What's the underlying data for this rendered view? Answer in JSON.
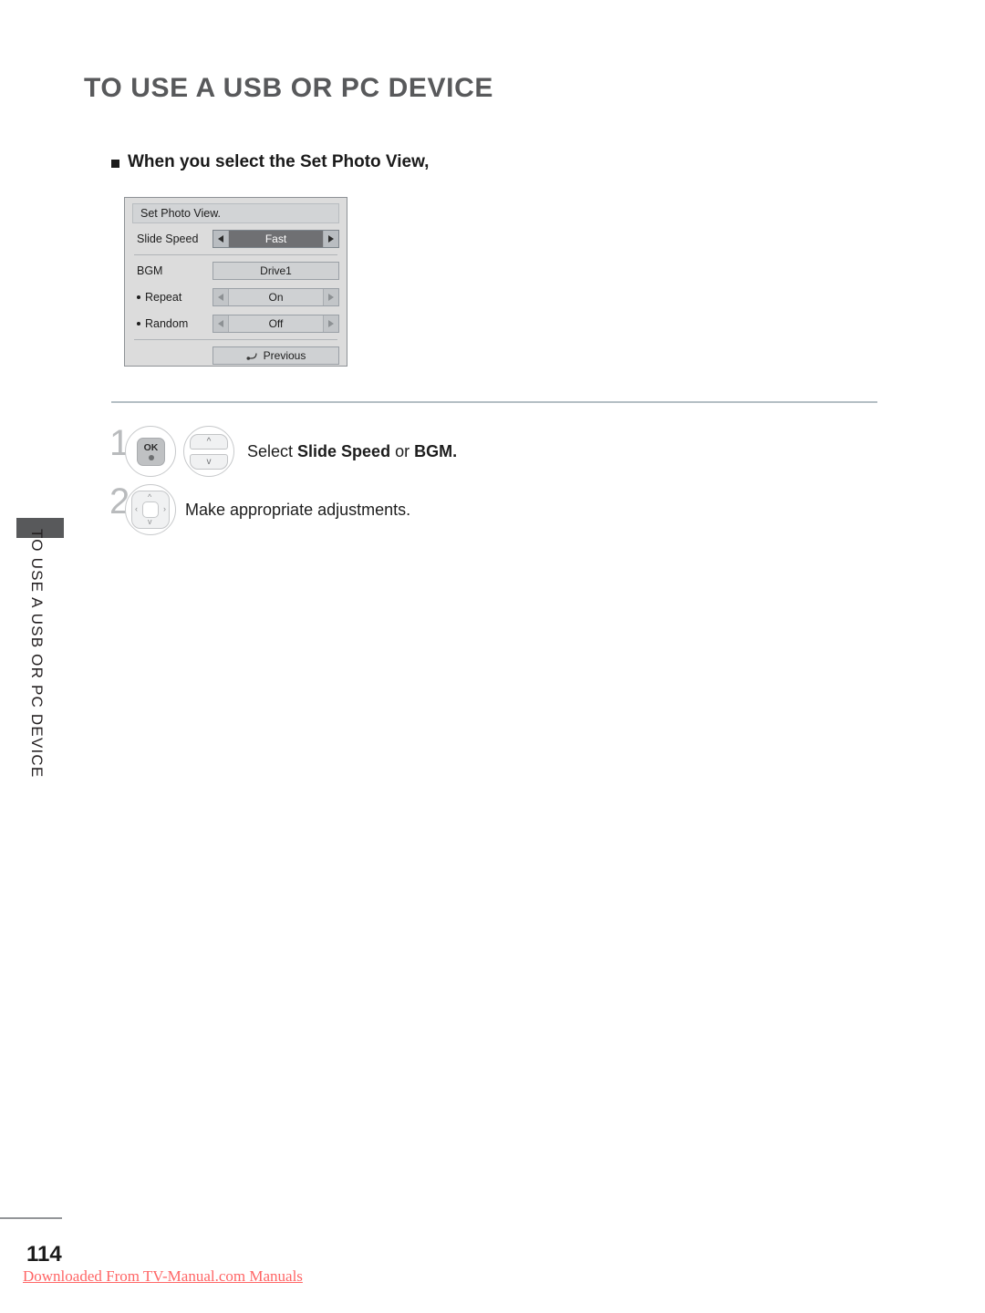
{
  "page": {
    "heading": "TO USE A USB OR PC DEVICE",
    "section_heading": "When you select the Set Photo View,",
    "page_number": "114",
    "download_note": "Downloaded From TV-Manual.com Manuals",
    "side_tab_label": "TO USE A USB OR PC DEVICE",
    "colors": {
      "heading_gray": "#58595b",
      "rule_blue_gray": "#b4bec4",
      "panel_bg": "#dcdcdc",
      "selected_value_bg": "#6f7073",
      "note_red": "#ff6666",
      "side_tab_block": "#58595b"
    }
  },
  "osd": {
    "title": "Set Photo View.",
    "rows": [
      {
        "label": "Slide Speed",
        "control": "spinner",
        "value": "Fast",
        "selected": true,
        "left_icon": "left-triangle-icon",
        "right_icon": "right-triangle-icon"
      },
      {
        "label": "BGM",
        "control": "button",
        "value": "Drive1",
        "selected": false
      },
      {
        "label": "Repeat",
        "sub": true,
        "control": "spinner",
        "value": "On",
        "selected": false,
        "left_icon": "left-triangle-icon",
        "right_icon": "right-triangle-icon"
      },
      {
        "label": "Random",
        "sub": true,
        "control": "spinner",
        "value": "Off",
        "selected": false,
        "left_icon": "left-triangle-icon",
        "right_icon": "right-triangle-icon"
      }
    ],
    "previous_button": {
      "label": "Previous",
      "icon": "return-arrow-icon"
    }
  },
  "steps": [
    {
      "number": "1",
      "keys": [
        "ok-button",
        "up-down-button"
      ],
      "ok_label": "OK",
      "text_plain_1": "Select ",
      "text_bold_1": "Slide Speed",
      "text_plain_2": " or ",
      "text_bold_2": "BGM.",
      "full_text": "Select Slide Speed or BGM."
    },
    {
      "number": "2",
      "keys": [
        "navigation-dpad-button"
      ],
      "full_text": "Make appropriate adjustments."
    }
  ]
}
